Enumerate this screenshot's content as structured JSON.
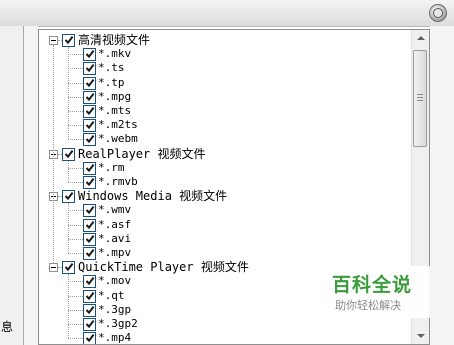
{
  "left_panel": {
    "label": "息"
  },
  "tree": {
    "groups": [
      {
        "label": "高清视频文件",
        "checked": true,
        "expanded": true,
        "items": [
          {
            "label": "*.mkv",
            "checked": true
          },
          {
            "label": "*.ts",
            "checked": true
          },
          {
            "label": "*.tp",
            "checked": true
          },
          {
            "label": "*.mpg",
            "checked": true
          },
          {
            "label": "*.mts",
            "checked": true
          },
          {
            "label": "*.m2ts",
            "checked": true
          },
          {
            "label": "*.webm",
            "checked": true
          }
        ]
      },
      {
        "label": "RealPlayer 视频文件",
        "checked": true,
        "expanded": true,
        "items": [
          {
            "label": "*.rm",
            "checked": true
          },
          {
            "label": "*.rmvb",
            "checked": true
          }
        ]
      },
      {
        "label": "Windows Media 视频文件",
        "checked": true,
        "expanded": true,
        "items": [
          {
            "label": "*.wmv",
            "checked": true
          },
          {
            "label": "*.asf",
            "checked": true
          },
          {
            "label": "*.avi",
            "checked": true
          },
          {
            "label": "*.mpv",
            "checked": true
          }
        ]
      },
      {
        "label": "QuickTime Player 视频文件",
        "checked": true,
        "expanded": true,
        "items": [
          {
            "label": "*.mov",
            "checked": true
          },
          {
            "label": "*.qt",
            "checked": true
          },
          {
            "label": "*.3gp",
            "checked": true
          },
          {
            "label": "*.3gp2",
            "checked": true
          },
          {
            "label": "*.mp4",
            "checked": true
          }
        ]
      }
    ]
  },
  "watermark": {
    "title": "百科全说",
    "subtitle": "助你轻松解决"
  },
  "colors": {
    "check": "#1a1a1a",
    "checkbox_border": "#1c5180",
    "watermark_green": "#3a9c3a"
  },
  "icons": {
    "close": "close-circle-icon",
    "expander": "minus-box-icon",
    "check": "checkmark-icon",
    "scroll_up": "arrow-up-icon",
    "scroll_down": "arrow-down-icon"
  }
}
